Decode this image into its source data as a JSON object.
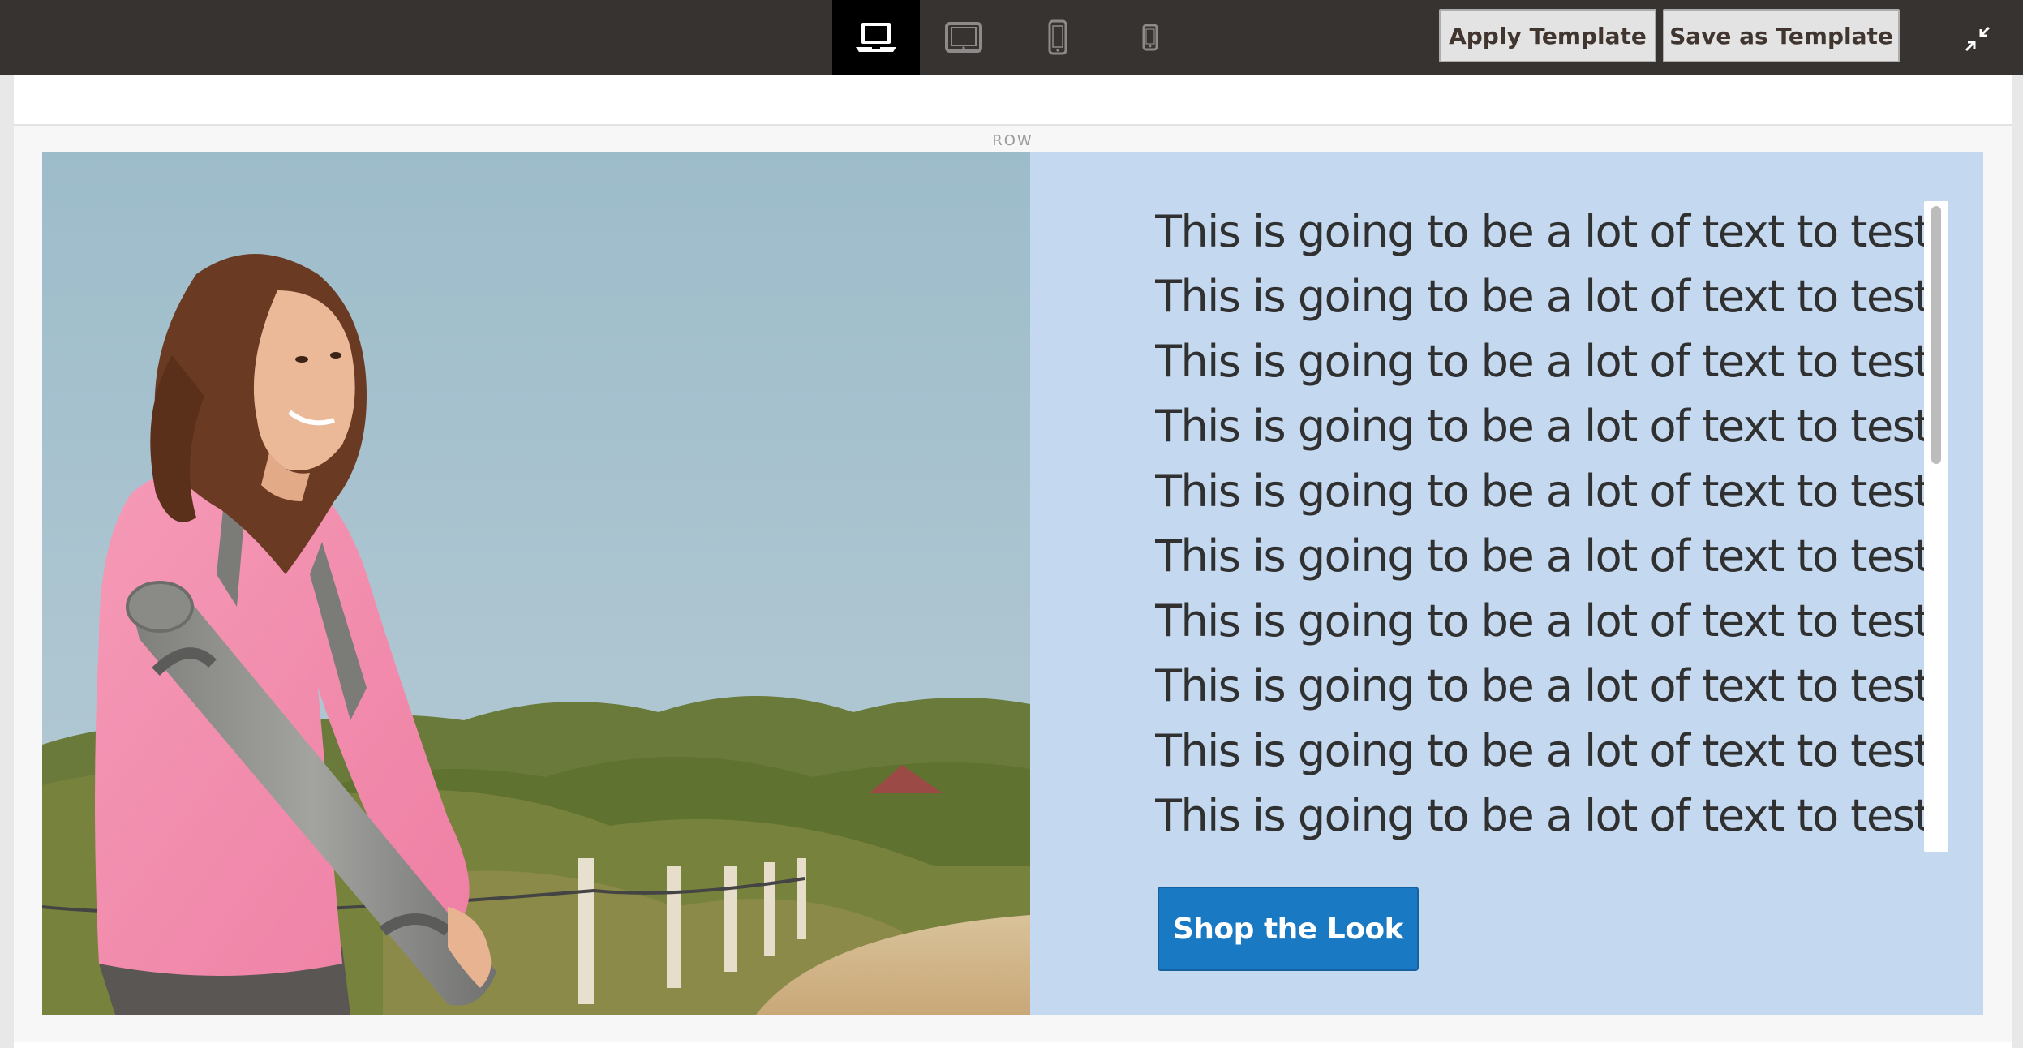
{
  "toolbar": {
    "devices": [
      {
        "icon": "laptop-icon",
        "active": true
      },
      {
        "icon": "tablet-landscape-icon",
        "active": false
      },
      {
        "icon": "mobile-icon",
        "active": false
      },
      {
        "icon": "mobile-small-icon",
        "active": false
      }
    ],
    "apply_template_label": "Apply Template",
    "save_as_template_label": "Save as Template",
    "collapse_icon": "collapse-fullscreen-icon"
  },
  "stage": {
    "row_label": "ROW",
    "image": {
      "icon": "photo-woman-yoga-mat"
    },
    "text_lines": [
      "This is going to be a lot of text to test.",
      "This is going to be a lot of text to test.",
      "This is going to be a lot of text to test.",
      "This is going to be a lot of text to test.",
      "This is going to be a lot of text to test.",
      "This is going to be a lot of text to test.",
      "This is going to be a lot of text to test.",
      "This is going to be a lot of text to test.",
      "This is going to be a lot of text to test.",
      "This is going to be a lot of text to test."
    ],
    "button_label": "Shop the Look"
  },
  "colors": {
    "toolbar_bg": "#373330",
    "active_device_bg": "#000000",
    "banner_bg": "#c4d8ef",
    "button_bg": "#1979c3",
    "text": "#303030"
  }
}
